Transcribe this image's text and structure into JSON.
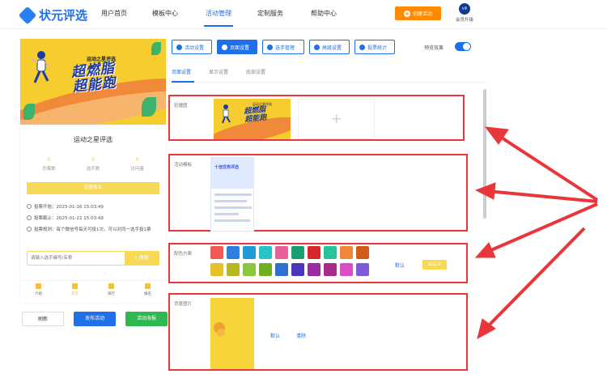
{
  "header": {
    "logo_text": "状元评选",
    "nav": [
      "用户首页",
      "模板中心",
      "活动管理",
      "定制服务",
      "帮助中心"
    ],
    "active_nav": "活动管理",
    "create_button": "创建活动",
    "vip_label": "会员升级",
    "vip_badge": "VIP"
  },
  "preview": {
    "banner_small_title": "运动之星评选",
    "banner_big_title_line1": "超燃脂",
    "banner_big_title_line2": "超能跑",
    "card_title": "运动之星评选",
    "stats": [
      {
        "value": "0",
        "label": "总票数"
      },
      {
        "value": "0",
        "label": "选手数"
      },
      {
        "value": "0",
        "label": "访问量"
      }
    ],
    "signup_button": "我要报名",
    "vote_start": "投票开始：2025-01-16 15:03:49",
    "vote_end": "投票截止：2025-01-22 15:03:49",
    "vote_rule": "投票规则：每个微信号每天可投1次，可以对同一选手投1票",
    "search_placeholder": "请输入选手编号/名称",
    "search_button": "搜索",
    "bottom_tabs": [
      "介绍",
      "首页",
      "排行",
      "报名"
    ],
    "active_tab": "首页"
  },
  "preview_actions": {
    "refresh": "刷新",
    "publish": "发布活动",
    "poster": "活动海报"
  },
  "toolbar": {
    "buttons": [
      "活动设置",
      "页面设置",
      "选手管理",
      "高级设置",
      "投票统计"
    ],
    "active": "页面设置",
    "preview_effect_label": "预览效果",
    "preview_effect_on": true
  },
  "subtabs": {
    "items": [
      "页面设置",
      "显示设置",
      "底部设置"
    ],
    "active": "页面设置"
  },
  "sections": {
    "carousel_label": "轮播图",
    "template_label": "活动模板",
    "template_thumb_title": "十佳优秀评选",
    "color_label": "配色方案",
    "color_default": "默认",
    "color_custom": "自定义",
    "bg_label": "背景图片",
    "bg_default": "默认",
    "bg_clear": "清除"
  },
  "colors": {
    "accent": "#1f6fe8",
    "create": "#ff8a00",
    "highlight_border": "#e8363b",
    "swatches_row1": [
      "#f25858",
      "#2f7fe0",
      "#1f9ad8",
      "#26c4c9",
      "#e8609a",
      "#1b9e74",
      "#d8262c",
      "#27c29a",
      "#f2863a",
      "#d15b1a"
    ],
    "swatches_row2": [
      "#e6c12a",
      "#b5b81e",
      "#8cc63f",
      "#6fb01f",
      "#2e6fd0",
      "#4a36b8",
      "#9b2da0",
      "#a62a86",
      "#d94ec4",
      "#7c5ad8"
    ]
  }
}
